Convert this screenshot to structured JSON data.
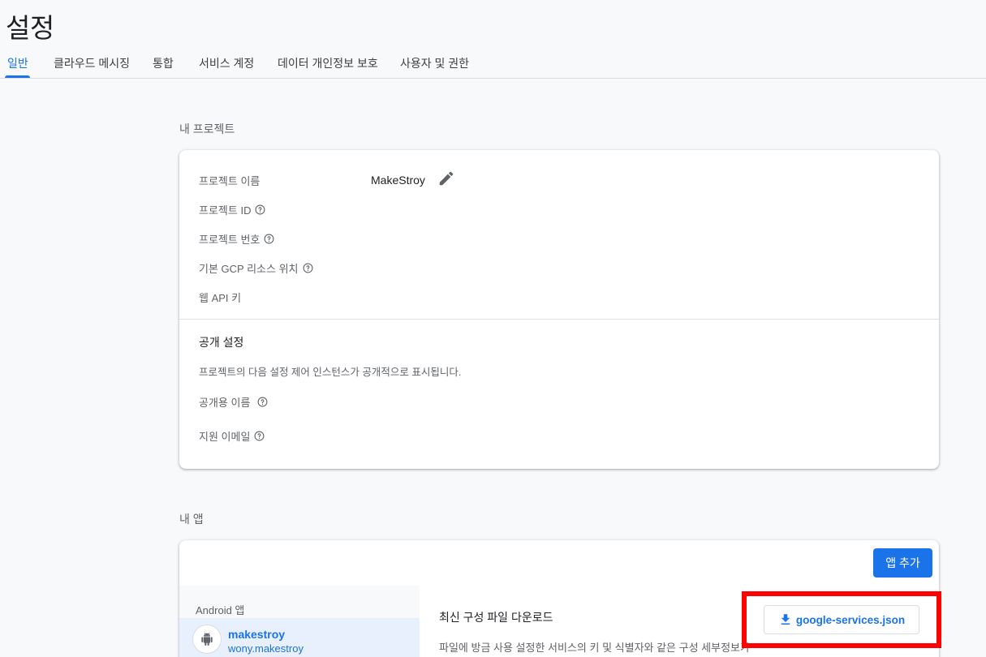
{
  "page": {
    "title": "설정"
  },
  "tabs": [
    {
      "label": "일반",
      "active": true
    },
    {
      "label": "클라우드 메시징"
    },
    {
      "label": "통합"
    },
    {
      "label": "서비스 계정"
    },
    {
      "label": "데이터 개인정보 보호"
    },
    {
      "label": "사용자 및 권한"
    }
  ],
  "project": {
    "section_label": "내 프로젝트",
    "name_label": "프로젝트 이름",
    "name_value": "MakeStroy",
    "id_label": "프로젝트 ID",
    "number_label": "프로젝트 번호",
    "gcp_location_label": "기본 GCP 리소스 위치",
    "web_api_key_label": "웹 API 키"
  },
  "public_settings": {
    "title": "공개 설정",
    "description": "프로젝트의 다음 설정 제어 인스턴스가 공개적으로 표시됩니다.",
    "public_name_label": "공개용 이름",
    "support_email_label": "지원 이메일"
  },
  "apps": {
    "section_label": "내 앱",
    "add_app_label": "앱 추가",
    "platform_header": "Android 앱",
    "items": [
      {
        "name": "makestroy",
        "package": "wony.makestroy"
      }
    ],
    "download_title": "최신 구성 파일 다운로드",
    "download_desc": "파일에 방금 사용 설정한 서비스의 키 및 식별자와 같은 구성 세부정보가",
    "download_button_label": "google-services.json"
  },
  "colors": {
    "accent": "#1a73e8",
    "highlight": "#ff0000"
  }
}
